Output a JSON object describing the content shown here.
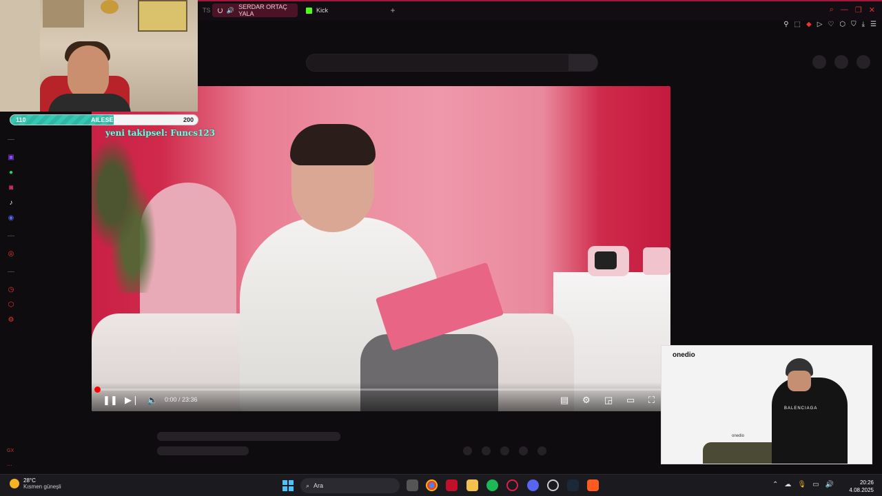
{
  "browser": {
    "tab_partial": "TS",
    "tab_active_label": "SERDAR ORTAÇ YALA",
    "tab_kick_label": "Kick",
    "new_tab": "+",
    "accent_color": "#e11d4b"
  },
  "webcam_overlay": {
    "goal_left": "110",
    "goal_label": "AILESEL",
    "goal_right": "200",
    "goal_progress_fraction": 0.55,
    "new_follower_text": "yeni takipsel: Funcs123"
  },
  "video_player": {
    "current_time": "0:00 / 23:36",
    "progress_fraction": 0.001,
    "progress_color": "#ff0000",
    "buttons": [
      "play-pause",
      "next",
      "volume",
      "subtitles",
      "settings",
      "miniplayer",
      "theater",
      "fullscreen"
    ]
  },
  "second_cam": {
    "brand": "onedio",
    "shirt_text": "BALENCIAGA",
    "sofa_brand": "onedio"
  },
  "sidebar": {
    "icons": [
      "twitch-icon",
      "whatsapp-icon",
      "instagram-icon",
      "tiktok-icon",
      "discord-icon",
      "player-icon",
      "history-icon",
      "extensions-icon",
      "settings-icon"
    ],
    "footer_label": "GX",
    "more": "..."
  },
  "taskbar": {
    "weather_temp": "28°C",
    "weather_desc": "Kısmen güneşli",
    "search_placeholder": "Ara",
    "time": "20:26",
    "date": "4.08.2025"
  }
}
